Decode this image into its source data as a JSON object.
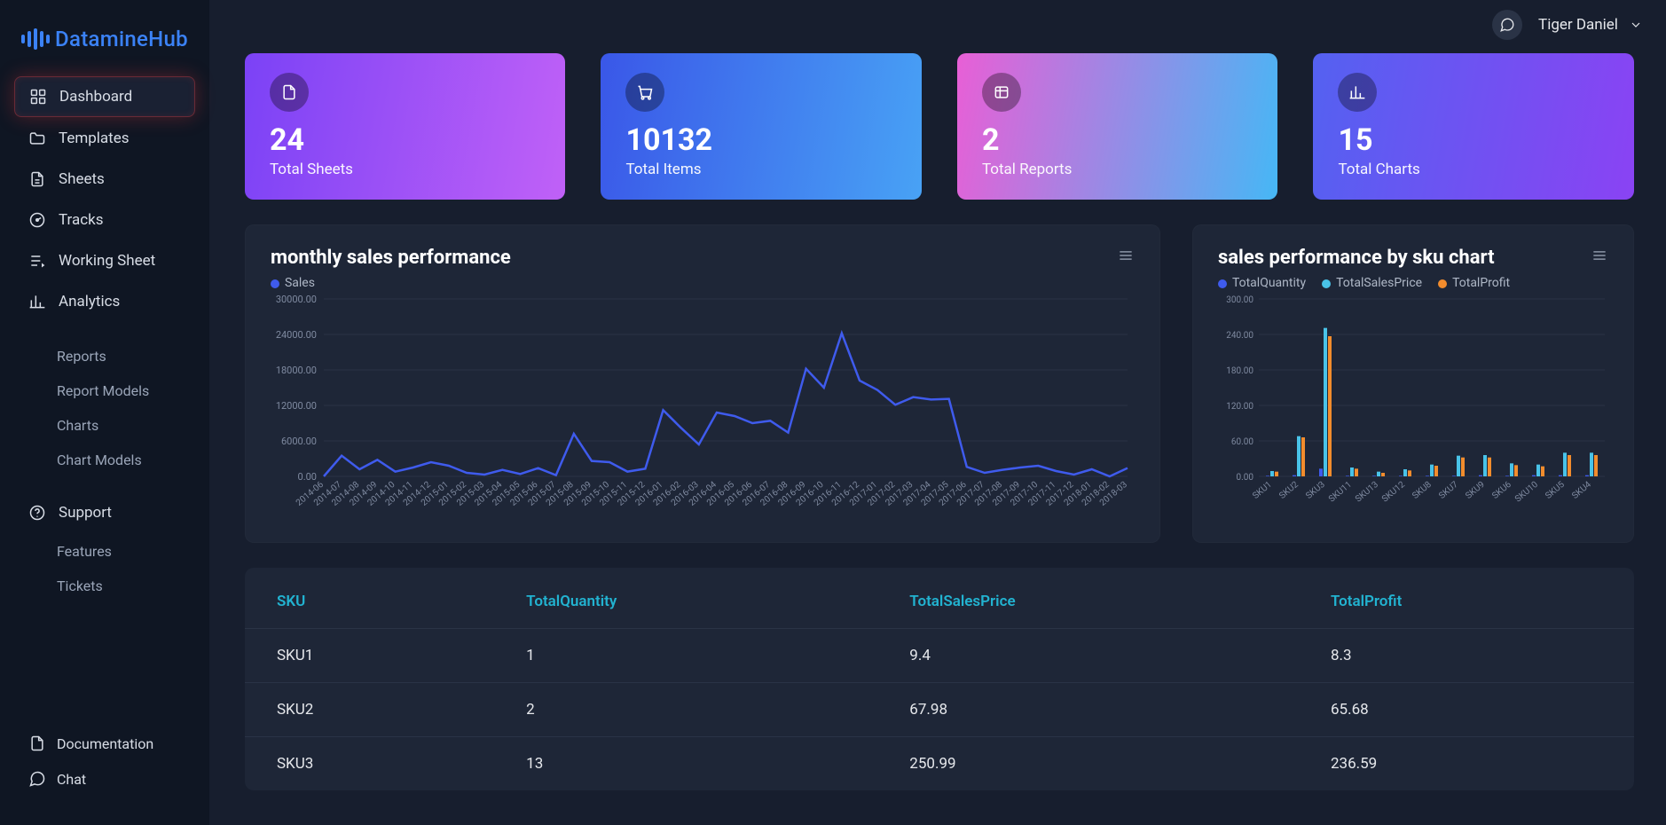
{
  "brand": "DatamineHub",
  "user": {
    "name": "Tiger Daniel"
  },
  "sidebar": {
    "items": [
      {
        "label": "Dashboard",
        "icon": "grid-icon",
        "active": true
      },
      {
        "label": "Templates",
        "icon": "folder-icon"
      },
      {
        "label": "Sheets",
        "icon": "file-icon"
      },
      {
        "label": "Tracks",
        "icon": "gauge-icon"
      },
      {
        "label": "Working Sheet",
        "icon": "playlist-icon"
      },
      {
        "label": "Analytics",
        "icon": "bars-icon"
      }
    ],
    "sub1": [
      {
        "label": "Reports"
      },
      {
        "label": "Report Models"
      },
      {
        "label": "Charts"
      },
      {
        "label": "Chart Models"
      }
    ],
    "support": {
      "label": "Support",
      "icon": "help-icon"
    },
    "sub2": [
      {
        "label": "Features"
      },
      {
        "label": "Tickets"
      }
    ],
    "bottom": [
      {
        "label": "Documentation",
        "icon": "doc-icon"
      },
      {
        "label": "Chat",
        "icon": "chat-icon"
      }
    ]
  },
  "cards": [
    {
      "value": "24",
      "label": "Total Sheets",
      "icon": "file-icon"
    },
    {
      "value": "10132",
      "label": "Total Items",
      "icon": "cart-icon"
    },
    {
      "value": "2",
      "label": "Total Reports",
      "icon": "report-icon"
    },
    {
      "value": "15",
      "label": "Total Charts",
      "icon": "chart-icon"
    }
  ],
  "panel1": {
    "title": "monthly sales performance",
    "legend": [
      {
        "name": "Sales",
        "color": "#3f5bed"
      }
    ]
  },
  "panel2": {
    "title": "sales performance by sku chart",
    "legend": [
      {
        "name": "TotalQuantity",
        "color": "#3f5bed"
      },
      {
        "name": "TotalSalesPrice",
        "color": "#49c3e8"
      },
      {
        "name": "TotalProfit",
        "color": "#f28c2d"
      }
    ]
  },
  "table": {
    "columns": [
      "SKU",
      "TotalQuantity",
      "TotalSalesPrice",
      "TotalProfit"
    ],
    "rows": [
      [
        "SKU1",
        "1",
        "9.4",
        "8.3"
      ],
      [
        "SKU2",
        "2",
        "67.98",
        "65.68"
      ],
      [
        "SKU3",
        "13",
        "250.99",
        "236.59"
      ]
    ]
  },
  "chart_data": [
    {
      "type": "line",
      "title": "monthly sales performance",
      "xlabel": "",
      "ylabel": "",
      "ylim": [
        0,
        30000
      ],
      "yticks": [
        0,
        6000,
        12000,
        18000,
        24000,
        30000
      ],
      "ytick_labels": [
        "0.00",
        "6000.00",
        "12000.00",
        "18000.00",
        "24000.00",
        "30000.00"
      ],
      "categories": [
        "2014-06",
        "2014-07",
        "2014-08",
        "2014-09",
        "2014-10",
        "2014-11",
        "2014-12",
        "2015-01",
        "2015-02",
        "2015-03",
        "2015-04",
        "2015-05",
        "2015-06",
        "2015-07",
        "2015-08",
        "2015-09",
        "2015-10",
        "2015-11",
        "2015-12",
        "2016-01",
        "2016-02",
        "2016-03",
        "2016-04",
        "2016-05",
        "2016-06",
        "2016-07",
        "2016-08",
        "2016-09",
        "2016-10",
        "2016-11",
        "2016-12",
        "2017-01",
        "2017-02",
        "2017-03",
        "2017-04",
        "2017-05",
        "2017-06",
        "2017-07",
        "2017-08",
        "2017-09",
        "2017-10",
        "2017-11",
        "2017-12",
        "2018-01",
        "2018-02",
        "2018-03"
      ],
      "series": [
        {
          "name": "Sales",
          "color": "#3f5bed",
          "values": [
            0,
            3500,
            1200,
            2800,
            800,
            1500,
            2400,
            1800,
            600,
            300,
            1100,
            400,
            1400,
            200,
            7200,
            2600,
            2400,
            800,
            1300,
            11200,
            8200,
            5400,
            10800,
            10200,
            9000,
            9400,
            7400,
            18200,
            15000,
            24200,
            16200,
            14600,
            12100,
            13400,
            13000,
            13100,
            1600,
            600,
            1100,
            1500,
            1800,
            900,
            300,
            1200,
            0,
            1400
          ]
        }
      ]
    },
    {
      "type": "bar",
      "title": "sales performance by sku chart",
      "xlabel": "",
      "ylabel": "",
      "ylim": [
        0,
        300
      ],
      "yticks": [
        0,
        60,
        120,
        180,
        240,
        300
      ],
      "ytick_labels": [
        "0.00",
        "60.00",
        "120.00",
        "180.00",
        "240.00",
        "300.00"
      ],
      "categories": [
        "SKU1",
        "SKU2",
        "SKU3",
        "SKU11",
        "SKU13",
        "SKU12",
        "SKU8",
        "SKU7",
        "SKU9",
        "SKU6",
        "SKU10",
        "SKU5",
        "SKU4"
      ],
      "series": [
        {
          "name": "TotalQuantity",
          "color": "#3f5bed",
          "values": [
            1,
            2,
            13,
            1,
            1,
            1,
            1,
            1,
            2,
            1,
            2,
            2,
            2
          ]
        },
        {
          "name": "TotalSalesPrice",
          "color": "#49c3e8",
          "values": [
            9,
            68,
            251,
            15,
            8,
            12,
            20,
            35,
            36,
            22,
            20,
            40,
            40
          ]
        },
        {
          "name": "TotalProfit",
          "color": "#f28c2d",
          "values": [
            8,
            66,
            237,
            13,
            6,
            10,
            18,
            32,
            32,
            19,
            17,
            36,
            36
          ]
        }
      ]
    }
  ]
}
